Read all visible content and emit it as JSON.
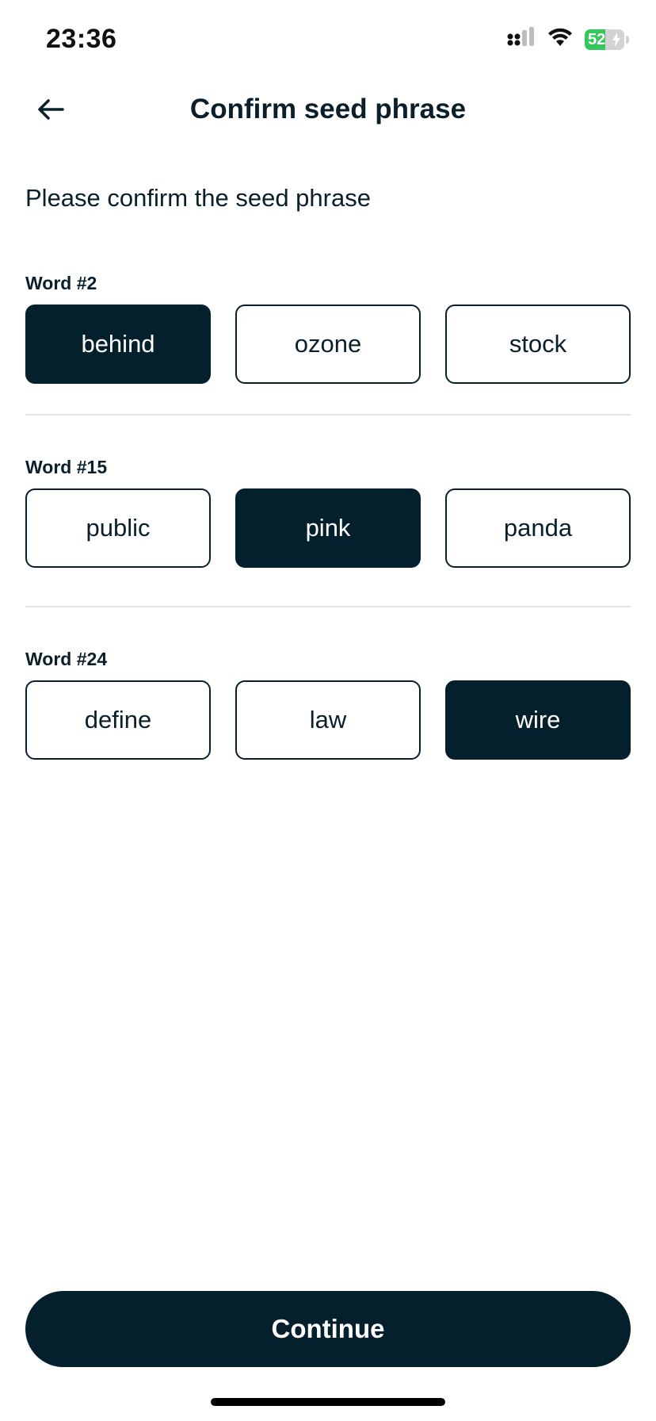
{
  "status_bar": {
    "time": "23:36",
    "battery_percent": "52",
    "battery_level": 0.52,
    "icons": [
      "cellular-signal-icon",
      "wifi-icon",
      "battery-charging-icon"
    ]
  },
  "header": {
    "title": "Confirm seed phrase",
    "back_icon": "arrow-left-icon"
  },
  "instructions": "Please confirm the seed phrase",
  "word_groups": [
    {
      "label": "Word #2",
      "options": [
        "behind",
        "ozone",
        "stock"
      ],
      "selected": "behind"
    },
    {
      "label": "Word #15",
      "options": [
        "public",
        "pink",
        "panda"
      ],
      "selected": "pink"
    },
    {
      "label": "Word #24",
      "options": [
        "define",
        "law",
        "wire"
      ],
      "selected": "wire"
    }
  ],
  "continue_label": "Continue",
  "colors": {
    "primary_dark": "#04202d",
    "text": "#0b1f2a",
    "battery_green": "#34c759"
  }
}
